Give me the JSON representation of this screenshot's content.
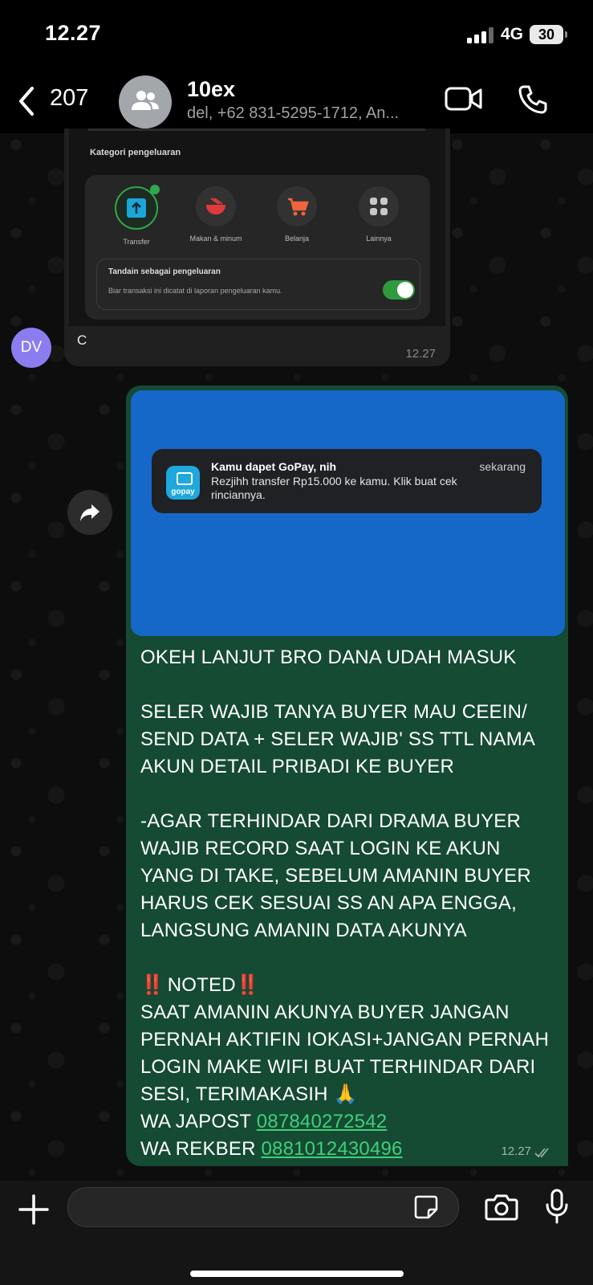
{
  "status_bar": {
    "time": "12.27",
    "network": "4G",
    "battery": "30"
  },
  "header": {
    "back_count": "207",
    "title": "10ex",
    "subtitle": "del, +62 831-5295-1712, An..."
  },
  "incoming": {
    "screenshot": {
      "section_title": "Kategori pengeluaran",
      "categories": [
        {
          "label": "Transfer"
        },
        {
          "label": "Makan & minum"
        },
        {
          "label": "Belanja"
        },
        {
          "label": "Lainnya"
        }
      ],
      "toggle_title": "Tandain sebagai pengeluaran",
      "toggle_desc": "Biar transaksi ini dicatat di laporan pengeluaran kamu."
    },
    "caption": "C",
    "time": "12.27",
    "sender_initials": "DV"
  },
  "outgoing": {
    "notification": {
      "app_label": "gopay",
      "title": "Kamu dapet GoPay, nih",
      "time": "sekarang",
      "body": "Rezjihh transfer Rp15.000 ke kamu. Klik buat cek rinciannya."
    },
    "para1": "OKEH LANJUT BRO DANA UDAH MASUK",
    "para2": "SELER WAJIB TANYA BUYER MAU CEEIN/ SEND DATA + SELER WAJIB' SS TTL NAMA AKUN DETAIL PRIBADI KE BUYER",
    "para3": "-AGAR TERHINDAR DARI DRAMA BUYER WAJIB RECORD SAAT LOGIN KE AKUN YANG DI TAKE, SEBELUM AMANIN BUYER HARUS CEK SESUAI SS AN APA ENGGA, LANGSUNG AMANIN DATA AKUNYA",
    "noted_marks": "‼️",
    "noted_label": "NOTED",
    "para4": "SAAT AMANIN AKUNYA BUYER JANGAN PERNAH AKTIFIN IOKASI+JANGAN PERNAH LOGIN MAKE WIFI BUAT TERHINDAR DARI SESI, TERIMAKASIH 🙏",
    "japost_label": "WA JAPOST",
    "japost_number": "087840272542",
    "rekber_label": "WA REKBER",
    "rekber_number": "0881012430496",
    "time": "12.27"
  },
  "colors": {
    "outgoing_bubble": "#154a33",
    "incoming_bubble": "#202020",
    "link": "#3fd07a",
    "image_background": "#1568c8"
  },
  "icons": [
    "back-chevron-icon",
    "group-avatar-icon",
    "video-call-icon",
    "phone-icon",
    "forward-icon",
    "plus-icon",
    "sticker-icon",
    "camera-icon",
    "microphone-icon",
    "double-check-icon"
  ]
}
